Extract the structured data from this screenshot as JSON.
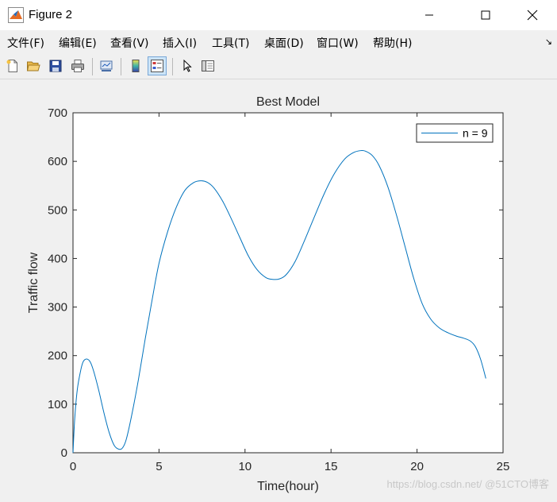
{
  "window": {
    "title": "Figure 2",
    "controls": [
      "minimize",
      "maximize",
      "close"
    ]
  },
  "menu": [
    {
      "label": "文件(F)",
      "mnemonic": "F"
    },
    {
      "label": "编辑(E)",
      "mnemonic": "E"
    },
    {
      "label": "查看(V)",
      "mnemonic": "V"
    },
    {
      "label": "插入(I)",
      "mnemonic": "I"
    },
    {
      "label": "工具(T)",
      "mnemonic": "T"
    },
    {
      "label": "桌面(D)",
      "mnemonic": "D"
    },
    {
      "label": "窗口(W)",
      "mnemonic": "W"
    },
    {
      "label": "帮助(H)",
      "mnemonic": "H"
    }
  ],
  "toolbar": {
    "buttons": [
      "new-figure-icon",
      "open-file-icon",
      "save-icon",
      "print-icon",
      "link-plot-icon",
      "insert-colorbar-icon",
      "insert-legend-icon",
      "edit-plot-icon",
      "property-inspector-icon"
    ],
    "active": "insert-legend-icon"
  },
  "watermark": "https://blog.csdn.net/ @51CTO博客",
  "chart_data": {
    "type": "line",
    "title": "Best Model",
    "xlabel": "Time(hour)",
    "ylabel": "Traffic flow",
    "xlim": [
      0,
      25
    ],
    "ylim": [
      0,
      700
    ],
    "xticks": [
      0,
      5,
      10,
      15,
      20,
      25
    ],
    "yticks": [
      0,
      100,
      200,
      300,
      400,
      500,
      600,
      700
    ],
    "grid": false,
    "legend": {
      "position": "top-right",
      "entries": [
        "n = 9"
      ]
    },
    "series": [
      {
        "name": "n = 9",
        "color": "#0072BD",
        "x": [
          0,
          0.1,
          0.25,
          0.45,
          0.6,
          0.8,
          1.0,
          1.2,
          1.5,
          1.8,
          2.1,
          2.4,
          2.7,
          2.9,
          3.1,
          3.4,
          3.8,
          4.2,
          4.6,
          5.0,
          5.5,
          6.0,
          6.5,
          7.0,
          7.4,
          7.8,
          8.2,
          8.7,
          9.2,
          9.7,
          10.2,
          10.7,
          11.2,
          11.6,
          12.0,
          12.4,
          12.9,
          13.4,
          14.0,
          14.6,
          15.2,
          15.8,
          16.3,
          16.7,
          17.0,
          17.4,
          17.8,
          18.3,
          18.8,
          19.3,
          19.8,
          20.3,
          20.8,
          21.3,
          21.8,
          22.3,
          22.7,
          23.1,
          23.4,
          23.7,
          24.0
        ],
        "y": [
          0,
          70,
          130,
          170,
          188,
          193,
          187,
          168,
          128,
          82,
          42,
          15,
          7,
          11,
          28,
          75,
          150,
          235,
          315,
          390,
          455,
          505,
          540,
          556,
          560,
          557,
          545,
          518,
          482,
          443,
          405,
          377,
          361,
          357,
          358,
          367,
          393,
          432,
          483,
          533,
          575,
          605,
          618,
          622,
          621,
          612,
          591,
          548,
          490,
          425,
          360,
          307,
          275,
          257,
          247,
          240,
          236,
          230,
          218,
          192,
          153
        ]
      }
    ]
  }
}
